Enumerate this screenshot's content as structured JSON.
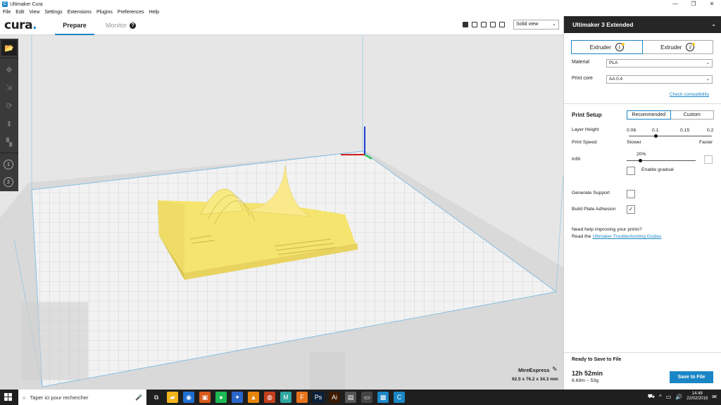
{
  "window": {
    "title": "Ultimaker Cura",
    "app_icon_glyph": "C",
    "controls": [
      "—",
      "❐",
      "✕"
    ]
  },
  "menu": [
    "File",
    "Edit",
    "View",
    "Settings",
    "Extensions",
    "Plugins",
    "Preferences",
    "Help"
  ],
  "header": {
    "logo": "cura",
    "logo_dot": ".",
    "tab_prepare": "Prepare",
    "tab_monitor": "Monitor",
    "help_glyph": "?",
    "view_mode": "Solid view",
    "chevron": "⌄"
  },
  "toolbar": {
    "icons": [
      "open-folder-icon",
      "move-icon",
      "scale-icon",
      "rotate-icon",
      "mirror-icon",
      "per-model-settings-icon"
    ],
    "extruders": [
      "1",
      "2"
    ],
    "open_glyph": "📂"
  },
  "job": {
    "name": "MireExpress",
    "dims": "92.5 x 76.2 x 34.3 mm",
    "edit_glyph": "✎"
  },
  "panel": {
    "printer": "Ultimaker 3 Extended",
    "chevron": "⌄",
    "extruder_tabs": [
      {
        "label": "Extruder",
        "num": "1"
      },
      {
        "label": "Extruder",
        "num": "2"
      }
    ],
    "material_label": "Material",
    "material_value": "PLA",
    "core_label": "Print core",
    "core_value": "AA 0.4",
    "check_link": "Check compatibility",
    "print_setup": "Print Setup",
    "modes": [
      "Recommended",
      "Custom"
    ],
    "layer_height_label": "Layer Height",
    "layer_heights": [
      "0.06",
      "0.1",
      "0.15",
      "0.2"
    ],
    "print_speed_label": "Print Speed",
    "slower": "Slower",
    "faster": "Faster",
    "infill_label": "Infill",
    "infill_value": "20%",
    "enable_gradual": "Enable gradual",
    "support_label": "Generate Support",
    "adhesion_label": "Build Plate Adhesion",
    "check_glyph": "✓",
    "help_line1": "Need help improving your prints?",
    "help_read": "Read the ",
    "help_link": "Ultimaker Troubleshooting Guides",
    "ready": "Ready to Save to File",
    "time": "12h 52min",
    "material_usage": "6.69m ~ 53g",
    "save_button": "Save to File"
  },
  "taskbar": {
    "search_placeholder": "Taper ici pour rechercher",
    "search_glyph": "○",
    "mic_glyph": "🎤",
    "apps": [
      {
        "icon": "task-view-icon",
        "glyph": "⧉",
        "color": "#1f1f1f"
      },
      {
        "icon": "file-explorer-icon",
        "glyph": "▰",
        "color": "#f2b51d"
      },
      {
        "icon": "firefox-icon",
        "glyph": "◉",
        "color": "#1f6fd1"
      },
      {
        "icon": "app-orange-icon",
        "glyph": "▣",
        "color": "#d85b1c"
      },
      {
        "icon": "spotify-icon",
        "glyph": "●",
        "color": "#1db954"
      },
      {
        "icon": "app-blue-icon",
        "glyph": "✦",
        "color": "#2a66c9"
      },
      {
        "icon": "vlc-icon",
        "glyph": "▲",
        "color": "#e8860c"
      },
      {
        "icon": "app-red-icon",
        "glyph": "◍",
        "color": "#c4401c"
      },
      {
        "icon": "monitor-app-icon",
        "glyph": "M",
        "color": "#2fa6a0"
      },
      {
        "icon": "fusion-icon",
        "glyph": "F",
        "color": "#e8731a"
      },
      {
        "icon": "photoshop-icon",
        "glyph": "Ps",
        "color": "#0a1f3a"
      },
      {
        "icon": "illustrator-icon",
        "glyph": "Ai",
        "color": "#3a1a00"
      },
      {
        "icon": "app-gray-icon",
        "glyph": "▤",
        "color": "#555555"
      },
      {
        "icon": "app-white-icon",
        "glyph": "▭",
        "color": "#444444"
      },
      {
        "icon": "app-cyan-icon",
        "glyph": "▩",
        "color": "#1b86c5"
      },
      {
        "icon": "cura-taskbar-icon",
        "glyph": "C",
        "color": "#1b86c5"
      }
    ],
    "tray_glyphs": [
      "⛟",
      "^",
      "▭",
      "🔊",
      "✉"
    ],
    "time": "14:48",
    "date": "22/02/2018"
  },
  "colors": {
    "accent": "#1b86c5",
    "model": "#f5e46e",
    "dark": "#262626"
  }
}
